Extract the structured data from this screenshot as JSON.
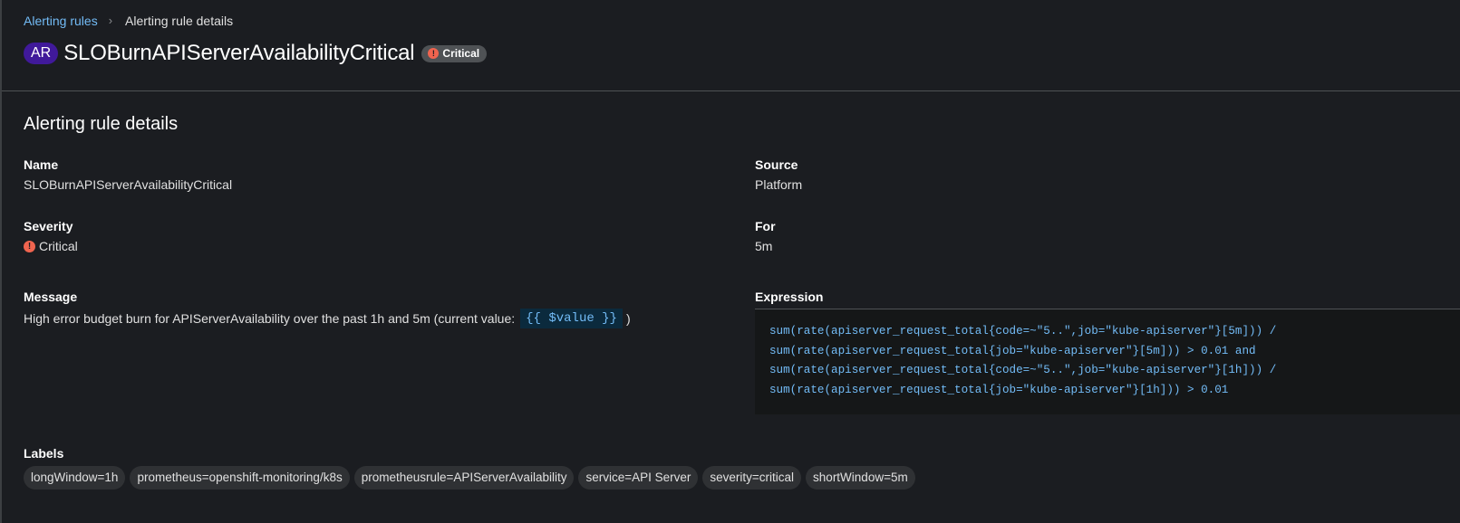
{
  "breadcrumb": {
    "link": "Alerting rules",
    "current": "Alerting rule details"
  },
  "header": {
    "resource_badge": "AR",
    "title": "SLOBurnAPIServerAvailabilityCritical",
    "severity_badge": "Critical",
    "severity_icon": "exclamation-circle-icon"
  },
  "details": {
    "section_title": "Alerting rule details",
    "name": {
      "label": "Name",
      "value": "SLOBurnAPIServerAvailabilityCritical"
    },
    "severity": {
      "label": "Severity",
      "value": "Critical"
    },
    "message": {
      "label": "Message",
      "prefix": "High error budget burn for APIServerAvailability over the past 1h and 5m (current value:",
      "code": "{{ $value }}",
      "suffix": ")"
    },
    "source": {
      "label": "Source",
      "value": "Platform"
    },
    "for": {
      "label": "For",
      "value": "5m"
    },
    "expression": {
      "label": "Expression",
      "lines": [
        "sum(rate(apiserver_request_total{code=~\"5..\",job=\"kube-apiserver\"}[5m])) /",
        "sum(rate(apiserver_request_total{job=\"kube-apiserver\"}[5m])) > 0.01 and",
        "sum(rate(apiserver_request_total{code=~\"5..\",job=\"kube-apiserver\"}[1h])) /",
        "sum(rate(apiserver_request_total{job=\"kube-apiserver\"}[1h])) > 0.01"
      ]
    },
    "labels": {
      "label": "Labels",
      "items": [
        "longWindow=1h",
        "prometheus=openshift-monitoring/k8s",
        "prometheusrule=APIServerAvailability",
        "service=API Server",
        "severity=critical",
        "shortWindow=5m"
      ]
    }
  },
  "colors": {
    "background": "#1b1d21",
    "link": "#73bcf7",
    "critical": "#f0644f",
    "badge_purple": "#40199a"
  }
}
